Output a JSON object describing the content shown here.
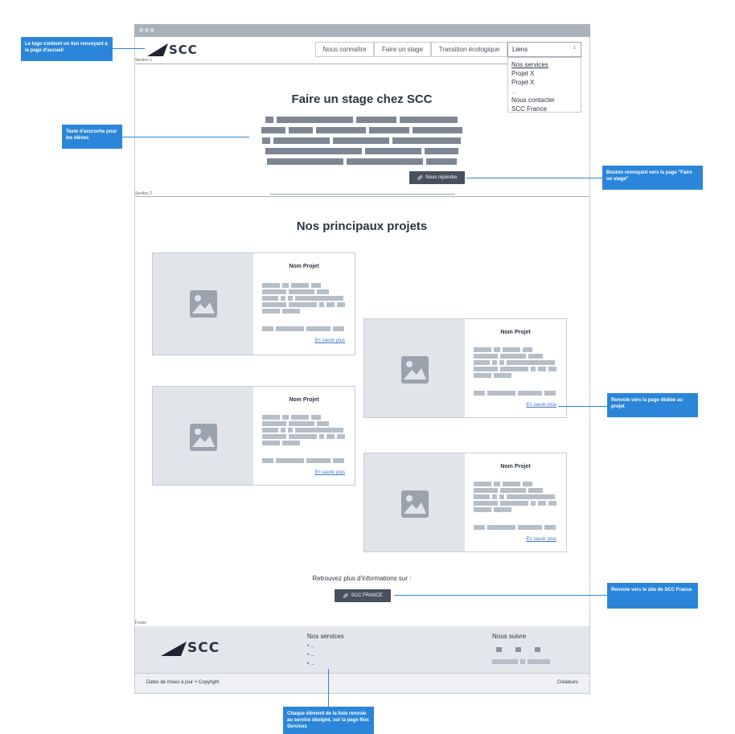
{
  "annotations": {
    "logo": "Le logo contient un lien renvoyant à la page d'accueil",
    "tagline": "Texte d'accroche pour les élèves",
    "join_button": "Bouton renvoyant vers la page \"Faire un stage\"",
    "project_link": "Renvoie vers la page dédiée au projet",
    "scc_france": "Renvoie vers le site de SCC France",
    "footer_list": "Chaque élément de la liste renvoie au service désigné, sur la page Nos Services"
  },
  "header": {
    "logo_text": "SCC",
    "nav": [
      "Nous connaître",
      "Faire un stage",
      "Transition écologique"
    ],
    "select_value": "Liens",
    "dropdown_items": [
      "Nos services",
      "Projet X",
      "Projet X",
      "...",
      "Nous contacter",
      "SCC France"
    ]
  },
  "sections": {
    "section1_label": "Section 1",
    "section2_label": "Section 2",
    "footer_label": "Footer"
  },
  "hero": {
    "title": "Faire un stage chez SCC",
    "join_label": "Nous rejoindre"
  },
  "projects": {
    "title": "Nos principaux projets",
    "cards": [
      {
        "name": "Nom Projet",
        "link": "En savoir plus"
      },
      {
        "name": "Nom Projet",
        "link": "En savoir plus"
      },
      {
        "name": "Nom Projet",
        "link": "En savoir plus"
      },
      {
        "name": "Nom Projet",
        "link": "En savoir plus"
      }
    ],
    "more_info": "Retrouvez plus d'informations sur :",
    "scc_france_label": "SCC FRANCE"
  },
  "footer": {
    "logo_text": "SCC",
    "services_title": "Nos services",
    "services_items": [
      "...",
      "...",
      "..."
    ],
    "follow_title": "Nous suivre",
    "copyright": "Dates de mises à jour + Copyright",
    "creators": "Créateurs"
  },
  "colors": {
    "accent": "#2b86d9",
    "dark_button": "#47505b",
    "placeholder": "#7d8794"
  }
}
